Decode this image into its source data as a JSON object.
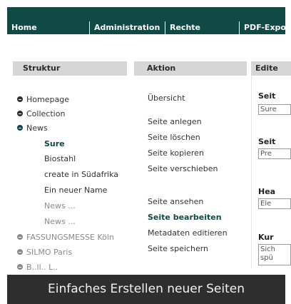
{
  "nav": {
    "home": "Home",
    "administration": "Administration",
    "rechte": "Rechte",
    "pdf": "PDF-Expor"
  },
  "columns": {
    "struktur": "Struktur",
    "aktion": "Aktion",
    "edit": "Edite"
  },
  "tree": {
    "homepage": "Homepage",
    "collection": "Collection",
    "news": "News",
    "news_children": [
      "Sure",
      "Biostahl",
      "create in Südafrika",
      "Ein neuer Name",
      "News ...",
      "News ..."
    ],
    "fassung": "FASSUNGSMESSE Köln",
    "silmo": "SILMO Paris",
    "partial": "B..ll.. L.."
  },
  "aktion": {
    "uebersicht": "Übersicht",
    "anlegen": "Seite anlegen",
    "loeschen": "Seite löschen",
    "kopieren": "Seite kopieren",
    "verschieben": "Seite verschieben",
    "ansehen": "Seite ansehen",
    "bearbeiten": "Seite bearbeiten",
    "metadaten": "Metadaten editieren",
    "speichern": "Seite speichern"
  },
  "edit": {
    "label1": "Seit",
    "value1": "Sure",
    "label2": "Seit",
    "value2": "Pre",
    "label3": "Hea",
    "value3": "Ele",
    "label4": "Kur",
    "value4": "Sich spü"
  },
  "caption": "Einfaches Erstellen neuer Seiten",
  "colors": {
    "brand": "#0f4a44",
    "header_grey": "#d6d6d6",
    "caption_bg": "#2e2e2e"
  }
}
